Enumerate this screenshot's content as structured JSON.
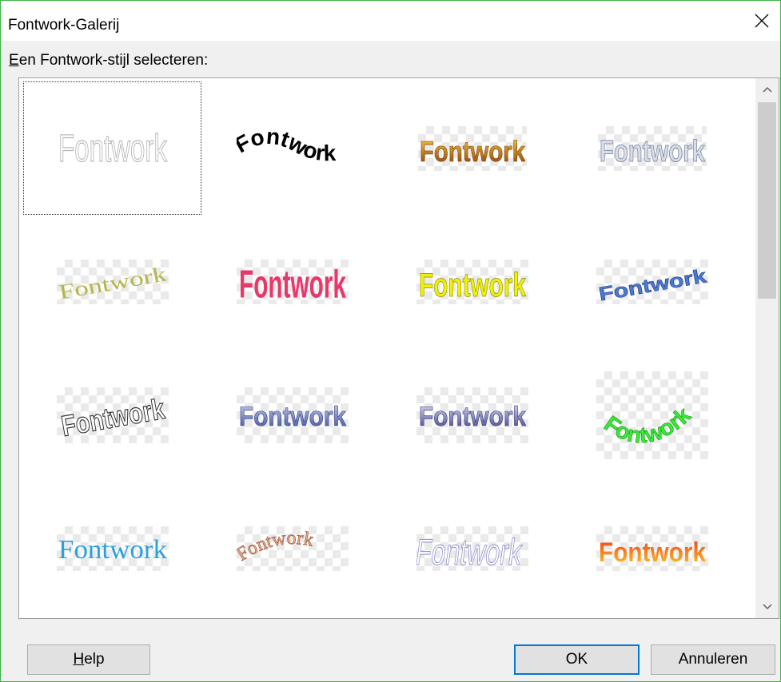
{
  "window": {
    "title": "Fontwork-Galerij"
  },
  "prompt": {
    "first": "E",
    "rest": "en Fontwork-stijl selecteren:"
  },
  "gallery": {
    "items": [
      {
        "label": "Fontwork"
      },
      {
        "label": "Fontwork"
      },
      {
        "label": "Fontwork"
      },
      {
        "label": "Fontwork"
      },
      {
        "label": "Fontwork"
      },
      {
        "label": "Fontwork"
      },
      {
        "label": "Fontwork"
      },
      {
        "label": "Fontwork"
      },
      {
        "label": "Fontwork"
      },
      {
        "label": "Fontwork"
      },
      {
        "label": "Fontwork"
      },
      {
        "label": "Fontwork"
      },
      {
        "label": "Fontwork"
      },
      {
        "label": "Fontwork"
      },
      {
        "label": "Fontwork"
      },
      {
        "label": "Fontwork"
      }
    ]
  },
  "buttons": {
    "help_first": "H",
    "help_rest": "elp",
    "ok": "OK",
    "cancel": "Annuleren"
  },
  "colors": {
    "window_border": "#3fb544",
    "ok_focus": "#0078d7"
  }
}
